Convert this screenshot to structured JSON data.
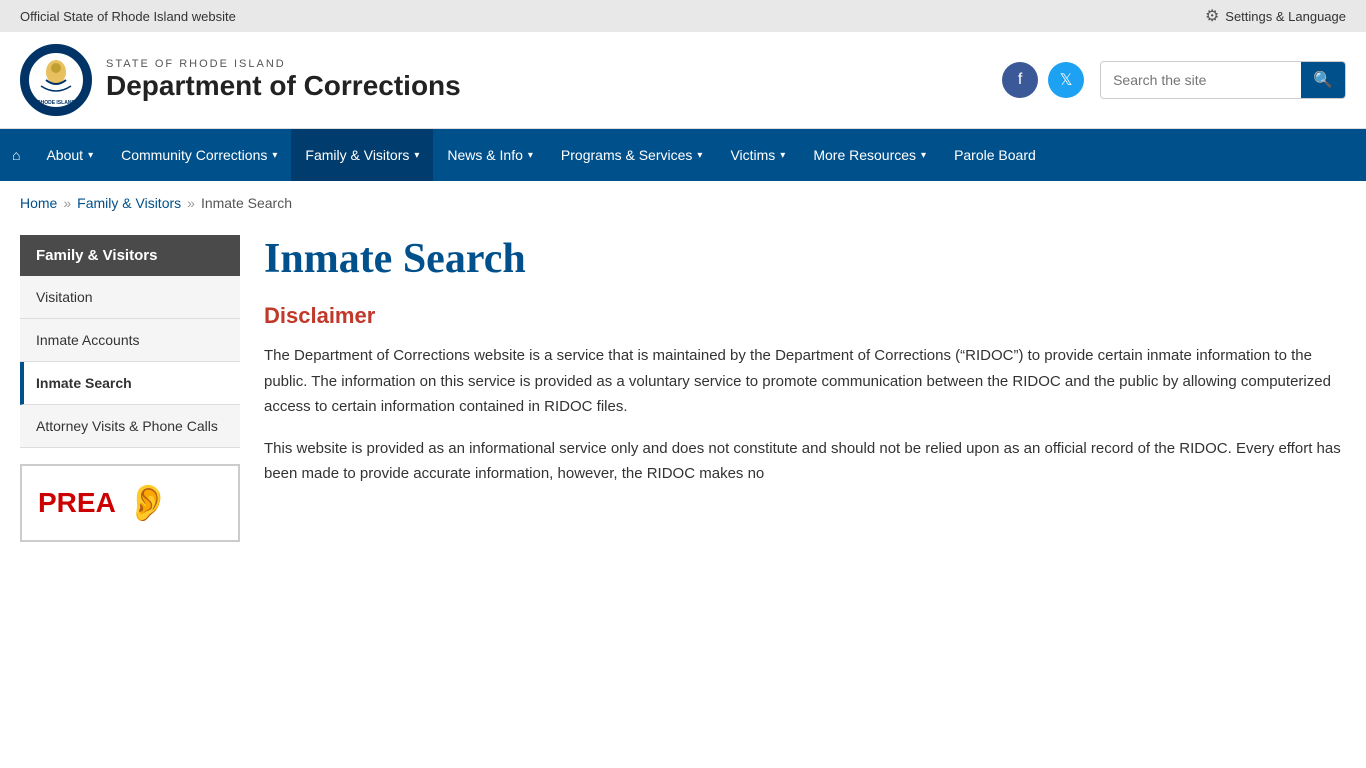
{
  "topbar": {
    "official_text": "Official State of Rhode Island website",
    "settings_label": "Settings & Language"
  },
  "header": {
    "state_name": "STATE OF RHODE ISLAND",
    "dept_name": "Department of Corrections",
    "search_placeholder": "Search the site"
  },
  "nav": {
    "home_label": "Home",
    "items": [
      {
        "label": "About",
        "has_dropdown": true
      },
      {
        "label": "Community Corrections",
        "has_dropdown": true
      },
      {
        "label": "Family & Visitors",
        "has_dropdown": true,
        "active": true
      },
      {
        "label": "News & Info",
        "has_dropdown": true
      },
      {
        "label": "Programs & Services",
        "has_dropdown": true
      },
      {
        "label": "Victims",
        "has_dropdown": true
      },
      {
        "label": "More Resources",
        "has_dropdown": true
      },
      {
        "label": "Parole Board",
        "has_dropdown": false
      }
    ]
  },
  "breadcrumb": {
    "items": [
      {
        "label": "Home",
        "link": true
      },
      {
        "label": "Family & Visitors",
        "link": true
      },
      {
        "label": "Inmate Search",
        "link": false
      }
    ]
  },
  "sidebar": {
    "section_title": "Family & Visitors",
    "items": [
      {
        "label": "Visitation",
        "active": false
      },
      {
        "label": "Inmate Accounts",
        "active": false
      },
      {
        "label": "Inmate Search",
        "active": true
      },
      {
        "label": "Attorney Visits & Phone Calls",
        "active": false
      }
    ]
  },
  "content": {
    "title": "Inmate Search",
    "disclaimer_heading": "Disclaimer",
    "paragraph1": "The Department of Corrections website is a service that is maintained by the Department of Corrections (“RIDOC”) to provide certain inmate information to the public. The information on this service is provided as a voluntary service to promote communication between the RIDOC and the public by allowing computerized access to certain information contained in RIDOC files.",
    "paragraph2": "This website is provided as an informational service only and does not constitute and should not be relied upon as an official record of the RIDOC. Every effort has been made to provide accurate information, however, the RIDOC makes no"
  }
}
